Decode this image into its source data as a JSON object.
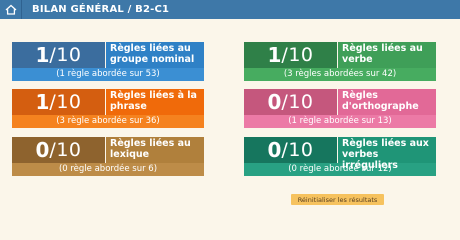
{
  "header": {
    "title": "BILAN GÉNÉRAL / B2-C1",
    "home_icon": "home-icon"
  },
  "cards": [
    {
      "score": "1",
      "total": "10",
      "label": "Règles liées au groupe nominal",
      "subtitle": "(1 règle abordée sur 53)",
      "color": "blue"
    },
    {
      "score": "1",
      "total": "10",
      "label": "Règles liées au verbe",
      "subtitle": "(3 règles abordées sur 42)",
      "color": "green"
    },
    {
      "score": "1",
      "total": "10",
      "label": "Règles liées à la phrase",
      "subtitle": "(3 règle abordée sur 36)",
      "color": "orange"
    },
    {
      "score": "0",
      "total": "10",
      "label": "Règles d'orthographe",
      "subtitle": "(1 règle abordée sur 13)",
      "color": "pink"
    },
    {
      "score": "0",
      "total": "10",
      "label": "Règles liées au lexique",
      "subtitle": "(0 règle abordée sur 6)",
      "color": "brown"
    },
    {
      "score": "0",
      "total": "10",
      "label": "Règles liées aux verbes irréguliers",
      "subtitle": "(0 règle abordée sur 12)",
      "color": "teal"
    }
  ],
  "reset_button": {
    "label": "Réinitialiser les résultats"
  }
}
